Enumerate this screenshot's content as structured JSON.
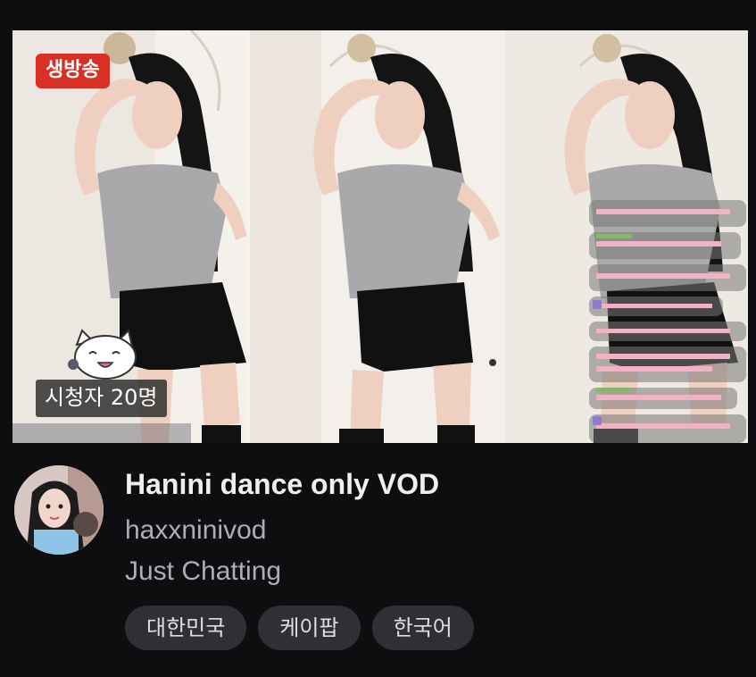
{
  "stream": {
    "live_label": "생방송",
    "viewer_label": "시청자 20명",
    "title": "Hanini dance only VOD",
    "channel": "haxxninivod",
    "category": "Just Chatting"
  },
  "tags": [
    "대한민국",
    "케이팝",
    "한국어"
  ],
  "colors": {
    "background": "#0e0e10",
    "live_badge": "#d93025",
    "tag_background": "#2f2f35",
    "secondary_text": "#adadb8"
  }
}
